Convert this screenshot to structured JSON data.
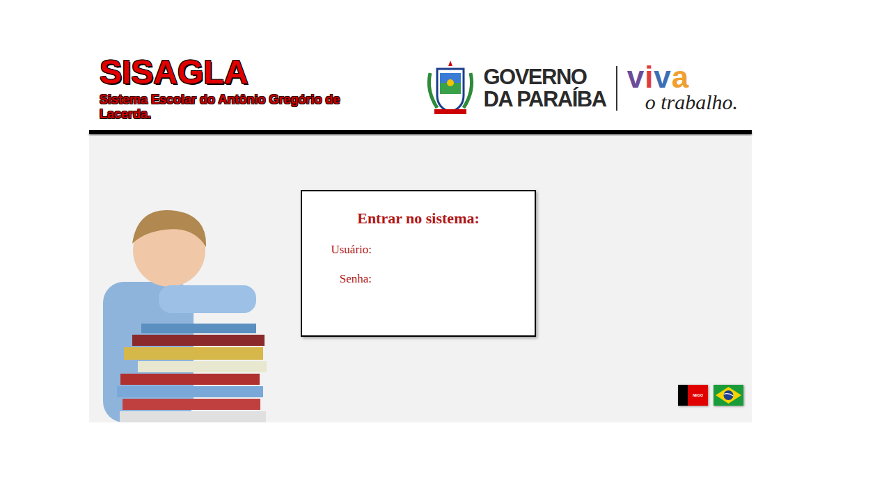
{
  "header": {
    "title": "SISAGLA",
    "subtitle": "Sistema Escolar do Antônio Gregório de Lacerda.",
    "government": {
      "line1": "GOVERNO",
      "line2": "DA PARAÍBA"
    },
    "slogan": {
      "word": "viva",
      "tagline": "o trabalho."
    }
  },
  "login": {
    "title": "Entrar no sistema:",
    "fields": [
      {
        "label": "Usuário:"
      },
      {
        "label": "Senha:"
      }
    ]
  },
  "flags": {
    "paraiba_text": "NEGO"
  }
}
